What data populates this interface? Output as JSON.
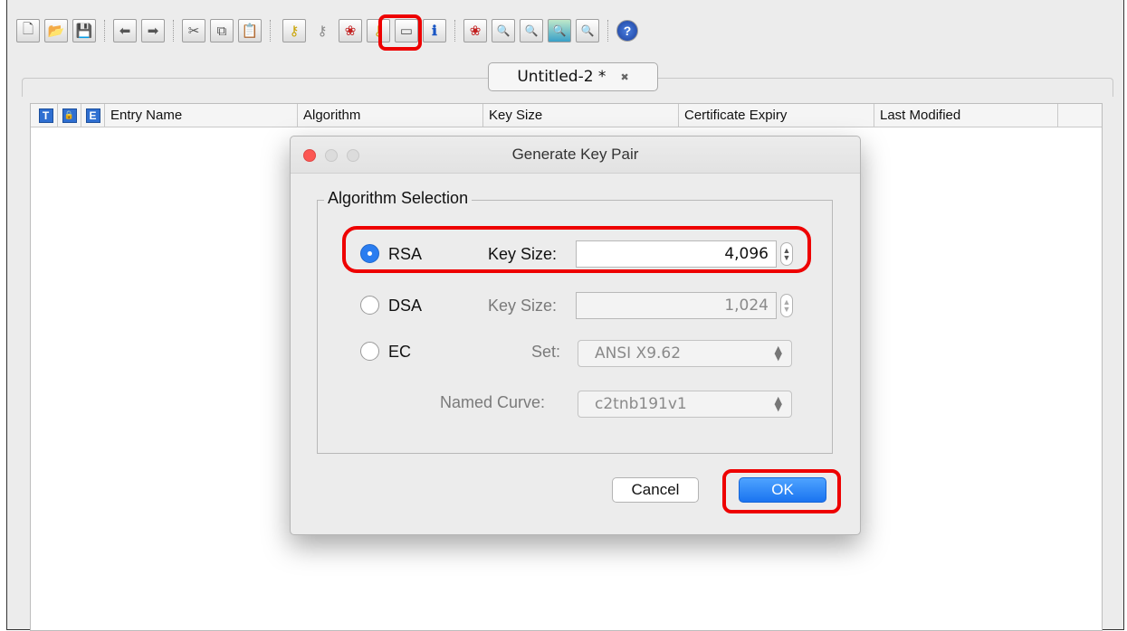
{
  "toolbar": {
    "buttons": [
      {
        "name": "new-keystore-icon",
        "glyph": "🗋"
      },
      {
        "name": "open-keystore-icon",
        "glyph": "📂"
      },
      {
        "name": "save-keystore-icon",
        "glyph": "💾"
      },
      {
        "name": "undo-icon",
        "glyph": "⬅"
      },
      {
        "name": "redo-icon",
        "glyph": "➡"
      },
      {
        "name": "cut-icon",
        "glyph": "✂"
      },
      {
        "name": "copy-icon",
        "glyph": "⧉"
      },
      {
        "name": "paste-icon",
        "glyph": "📋"
      },
      {
        "name": "generate-key-pair-icon",
        "glyph": "⚷"
      },
      {
        "name": "generate-secret-key-icon",
        "glyph": "⚷"
      },
      {
        "name": "import-trusted-certificate-icon",
        "glyph": "❀"
      },
      {
        "name": "import-key-pair-icon",
        "glyph": "⚷"
      },
      {
        "name": "set-password-icon",
        "glyph": "▭"
      },
      {
        "name": "properties-icon",
        "glyph": "ℹ"
      },
      {
        "name": "examine-file-icon",
        "glyph": "❀"
      },
      {
        "name": "examine-clipboard-icon",
        "glyph": "🔍"
      },
      {
        "name": "examine-ssl-icon",
        "glyph": "🔍"
      },
      {
        "name": "examine-url-icon",
        "glyph": "🔍"
      },
      {
        "name": "examine-csr-icon",
        "glyph": "🔍"
      },
      {
        "name": "help-icon",
        "glyph": "?"
      }
    ]
  },
  "tab": {
    "title": "Untitled-2 *",
    "close": "✖"
  },
  "table": {
    "icon_columns": [
      "T",
      "🔒",
      "E"
    ],
    "columns": [
      "Entry Name",
      "Algorithm",
      "Key Size",
      "Certificate Expiry",
      "Last Modified"
    ]
  },
  "dialog": {
    "title": "Generate Key Pair",
    "group_label": "Algorithm Selection",
    "rsa": {
      "label": "RSA",
      "key_size_label": "Key Size:",
      "key_size": "4,096",
      "selected": true
    },
    "dsa": {
      "label": "DSA",
      "key_size_label": "Key Size:",
      "key_size": "1,024",
      "selected": false
    },
    "ec": {
      "label": "EC",
      "set_label": "Set:",
      "set_value": "ANSI X9.62",
      "curve_label": "Named Curve:",
      "curve_value": "c2tnb191v1",
      "selected": false
    },
    "cancel_label": "Cancel",
    "ok_label": "OK"
  },
  "colors": {
    "highlight": "#ee0000",
    "accent": "#2a7df0"
  }
}
